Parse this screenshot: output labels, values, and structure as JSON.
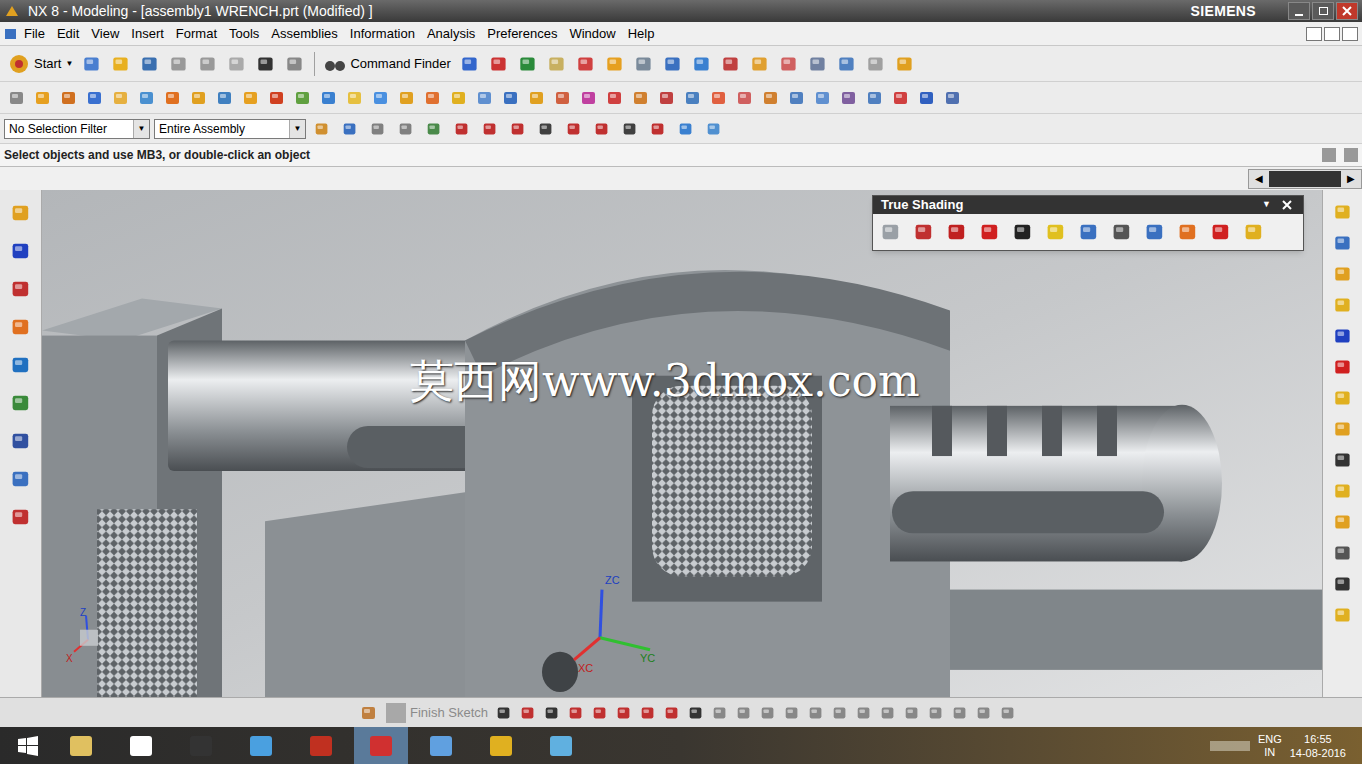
{
  "window": {
    "title": "NX 8 - Modeling - [assembly1 WRENCH.prt (Modified) ]",
    "brand": "SIEMENS"
  },
  "menu": {
    "items": [
      "File",
      "Edit",
      "View",
      "Insert",
      "Format",
      "Tools",
      "Assemblies",
      "Information",
      "Analysis",
      "Preferences",
      "Window",
      "Help"
    ]
  },
  "toolbar": {
    "start": "Start",
    "command_finder": "Command Finder"
  },
  "filters": {
    "selection": "No Selection Filter",
    "scope": "Entire Assembly"
  },
  "status": {
    "prompt": "Select objects and use MB3, or double-click an object"
  },
  "palette": {
    "title": "True Shading"
  },
  "viewport": {
    "watermark": "莫西网www.3dmox.com",
    "axes": {
      "z": "ZC",
      "y": "YC",
      "x": "XC"
    },
    "triad": {
      "z": "Z",
      "x": "X"
    }
  },
  "sketch_toolbar": {
    "finish": "Finish Sketch"
  },
  "taskbar": {
    "language": "ENG",
    "region": "IN",
    "time": "16:55",
    "date": "14-08-2016"
  }
}
